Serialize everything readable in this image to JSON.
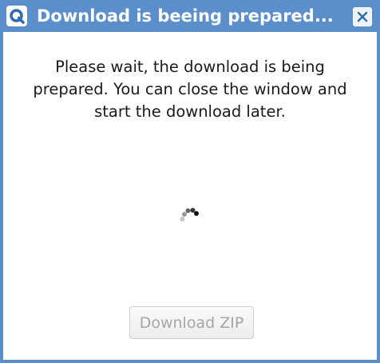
{
  "dialog": {
    "title": "Download is beeing prepared...",
    "message": "Please wait, the download is being prepared. You can close the window and start the download later.",
    "download_button_label": "Download ZIP",
    "download_button_disabled": true
  },
  "icons": {
    "app_logo": "qlik-q-logo-icon",
    "close": "close-x-icon",
    "spinner": "loading-spinner-icon"
  },
  "colors": {
    "titlebar": "#5b8fcb",
    "title_text": "#ffffff",
    "button_text_disabled": "#a6a6a6"
  }
}
